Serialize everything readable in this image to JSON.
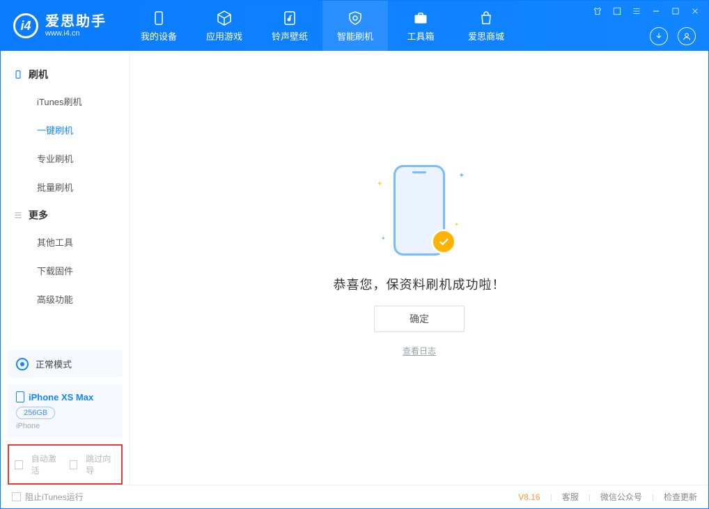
{
  "brand": {
    "name_cn": "爱思助手",
    "name_en": "www.i4.cn"
  },
  "nav": {
    "tabs": [
      {
        "label": "我的设备"
      },
      {
        "label": "应用游戏"
      },
      {
        "label": "铃声壁纸"
      },
      {
        "label": "智能刷机"
      },
      {
        "label": "工具箱"
      },
      {
        "label": "爱思商城"
      }
    ]
  },
  "sidebar": {
    "group1": {
      "title": "刷机"
    },
    "items1": [
      {
        "label": "iTunes刷机"
      },
      {
        "label": "一键刷机"
      },
      {
        "label": "专业刷机"
      },
      {
        "label": "批量刷机"
      }
    ],
    "group2": {
      "title": "更多"
    },
    "items2": [
      {
        "label": "其他工具"
      },
      {
        "label": "下载固件"
      },
      {
        "label": "高级功能"
      }
    ]
  },
  "mode": {
    "label": "正常模式"
  },
  "device": {
    "name": "iPhone XS Max",
    "capacity": "256GB",
    "type": "iPhone"
  },
  "options": {
    "auto_activate": "自动激活",
    "skip_guide": "跳过向导"
  },
  "footer": {
    "block_itunes": "阻止iTunes运行",
    "version": "V8.16",
    "support": "客服",
    "wechat": "微信公众号",
    "update": "检查更新"
  },
  "main": {
    "success_text": "恭喜您，保资料刷机成功啦！",
    "ok_label": "确定",
    "log_link": "查看日志"
  }
}
